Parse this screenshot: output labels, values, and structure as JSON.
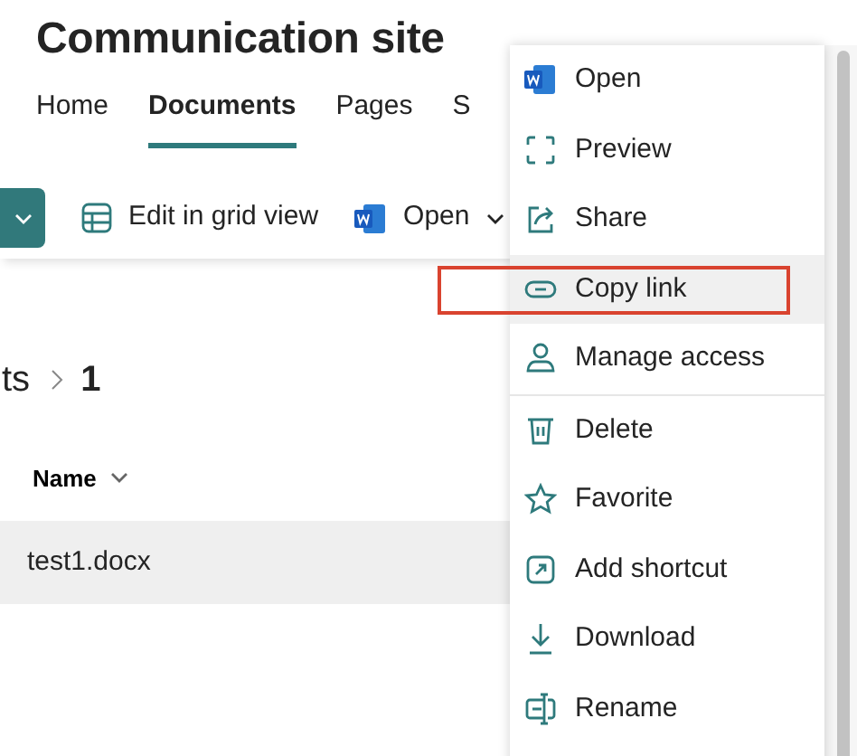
{
  "site": {
    "title": "Communication site"
  },
  "tabs": [
    {
      "label": "Home",
      "selected": false
    },
    {
      "label": "Documents",
      "selected": true
    },
    {
      "label": "Pages",
      "selected": false
    },
    {
      "label": "S",
      "selected": false
    }
  ],
  "toolbar": [
    {
      "kind": "grid",
      "label": "Edit in grid view"
    },
    {
      "kind": "word",
      "label": "Open"
    }
  ],
  "breadcrumb": [
    "ts",
    "1"
  ],
  "table": {
    "columns": [
      "Name"
    ],
    "rows": [
      {
        "name": "test1.docx",
        "selected": true
      }
    ]
  },
  "context_menu": {
    "groups": [
      [
        {
          "kind": "word",
          "label": "Open",
          "highlighted": false,
          "annotated": false
        },
        {
          "kind": "preview",
          "label": "Preview",
          "highlighted": false,
          "annotated": false
        },
        {
          "kind": "share",
          "label": "Share",
          "highlighted": false,
          "annotated": false
        },
        {
          "kind": "link",
          "label": "Copy link",
          "highlighted": true,
          "annotated": true
        },
        {
          "kind": "person",
          "label": "Manage access",
          "highlighted": false,
          "annotated": false
        }
      ],
      [
        {
          "kind": "trash",
          "label": "Delete",
          "highlighted": false,
          "annotated": false
        },
        {
          "kind": "star",
          "label": "Favorite",
          "highlighted": false,
          "annotated": false
        },
        {
          "kind": "shortcut",
          "label": "Add shortcut",
          "highlighted": false,
          "annotated": false
        },
        {
          "kind": "download",
          "label": "Download",
          "highlighted": false,
          "annotated": false
        },
        {
          "kind": "rename",
          "label": "Rename",
          "highlighted": false,
          "annotated": false
        }
      ]
    ]
  }
}
